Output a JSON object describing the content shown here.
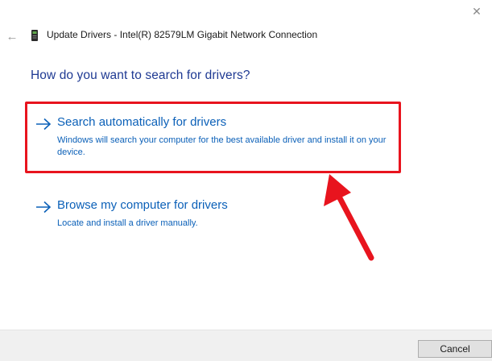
{
  "window": {
    "title": "Update Drivers - Intel(R) 82579LM Gigabit Network Connection",
    "close_glyph": "✕",
    "back_glyph": "←"
  },
  "question": "How do you want to search for drivers?",
  "options": [
    {
      "title": "Search automatically for drivers",
      "description": "Windows will search your computer for the best available driver and install it on your device."
    },
    {
      "title": "Browse my computer for drivers",
      "description": "Locate and install a driver manually."
    }
  ],
  "footer": {
    "cancel_label": "Cancel"
  },
  "colors": {
    "link_blue": "#0b60b8",
    "heading_blue": "#1f3a93",
    "highlight_red": "#e8141e",
    "footer_bg": "#f0f0f0"
  },
  "icons": {
    "back": "back-arrow-icon",
    "device": "network-device-icon",
    "close": "close-icon",
    "option_arrow": "right-arrow-icon",
    "annotation": "red-callout-arrow"
  }
}
